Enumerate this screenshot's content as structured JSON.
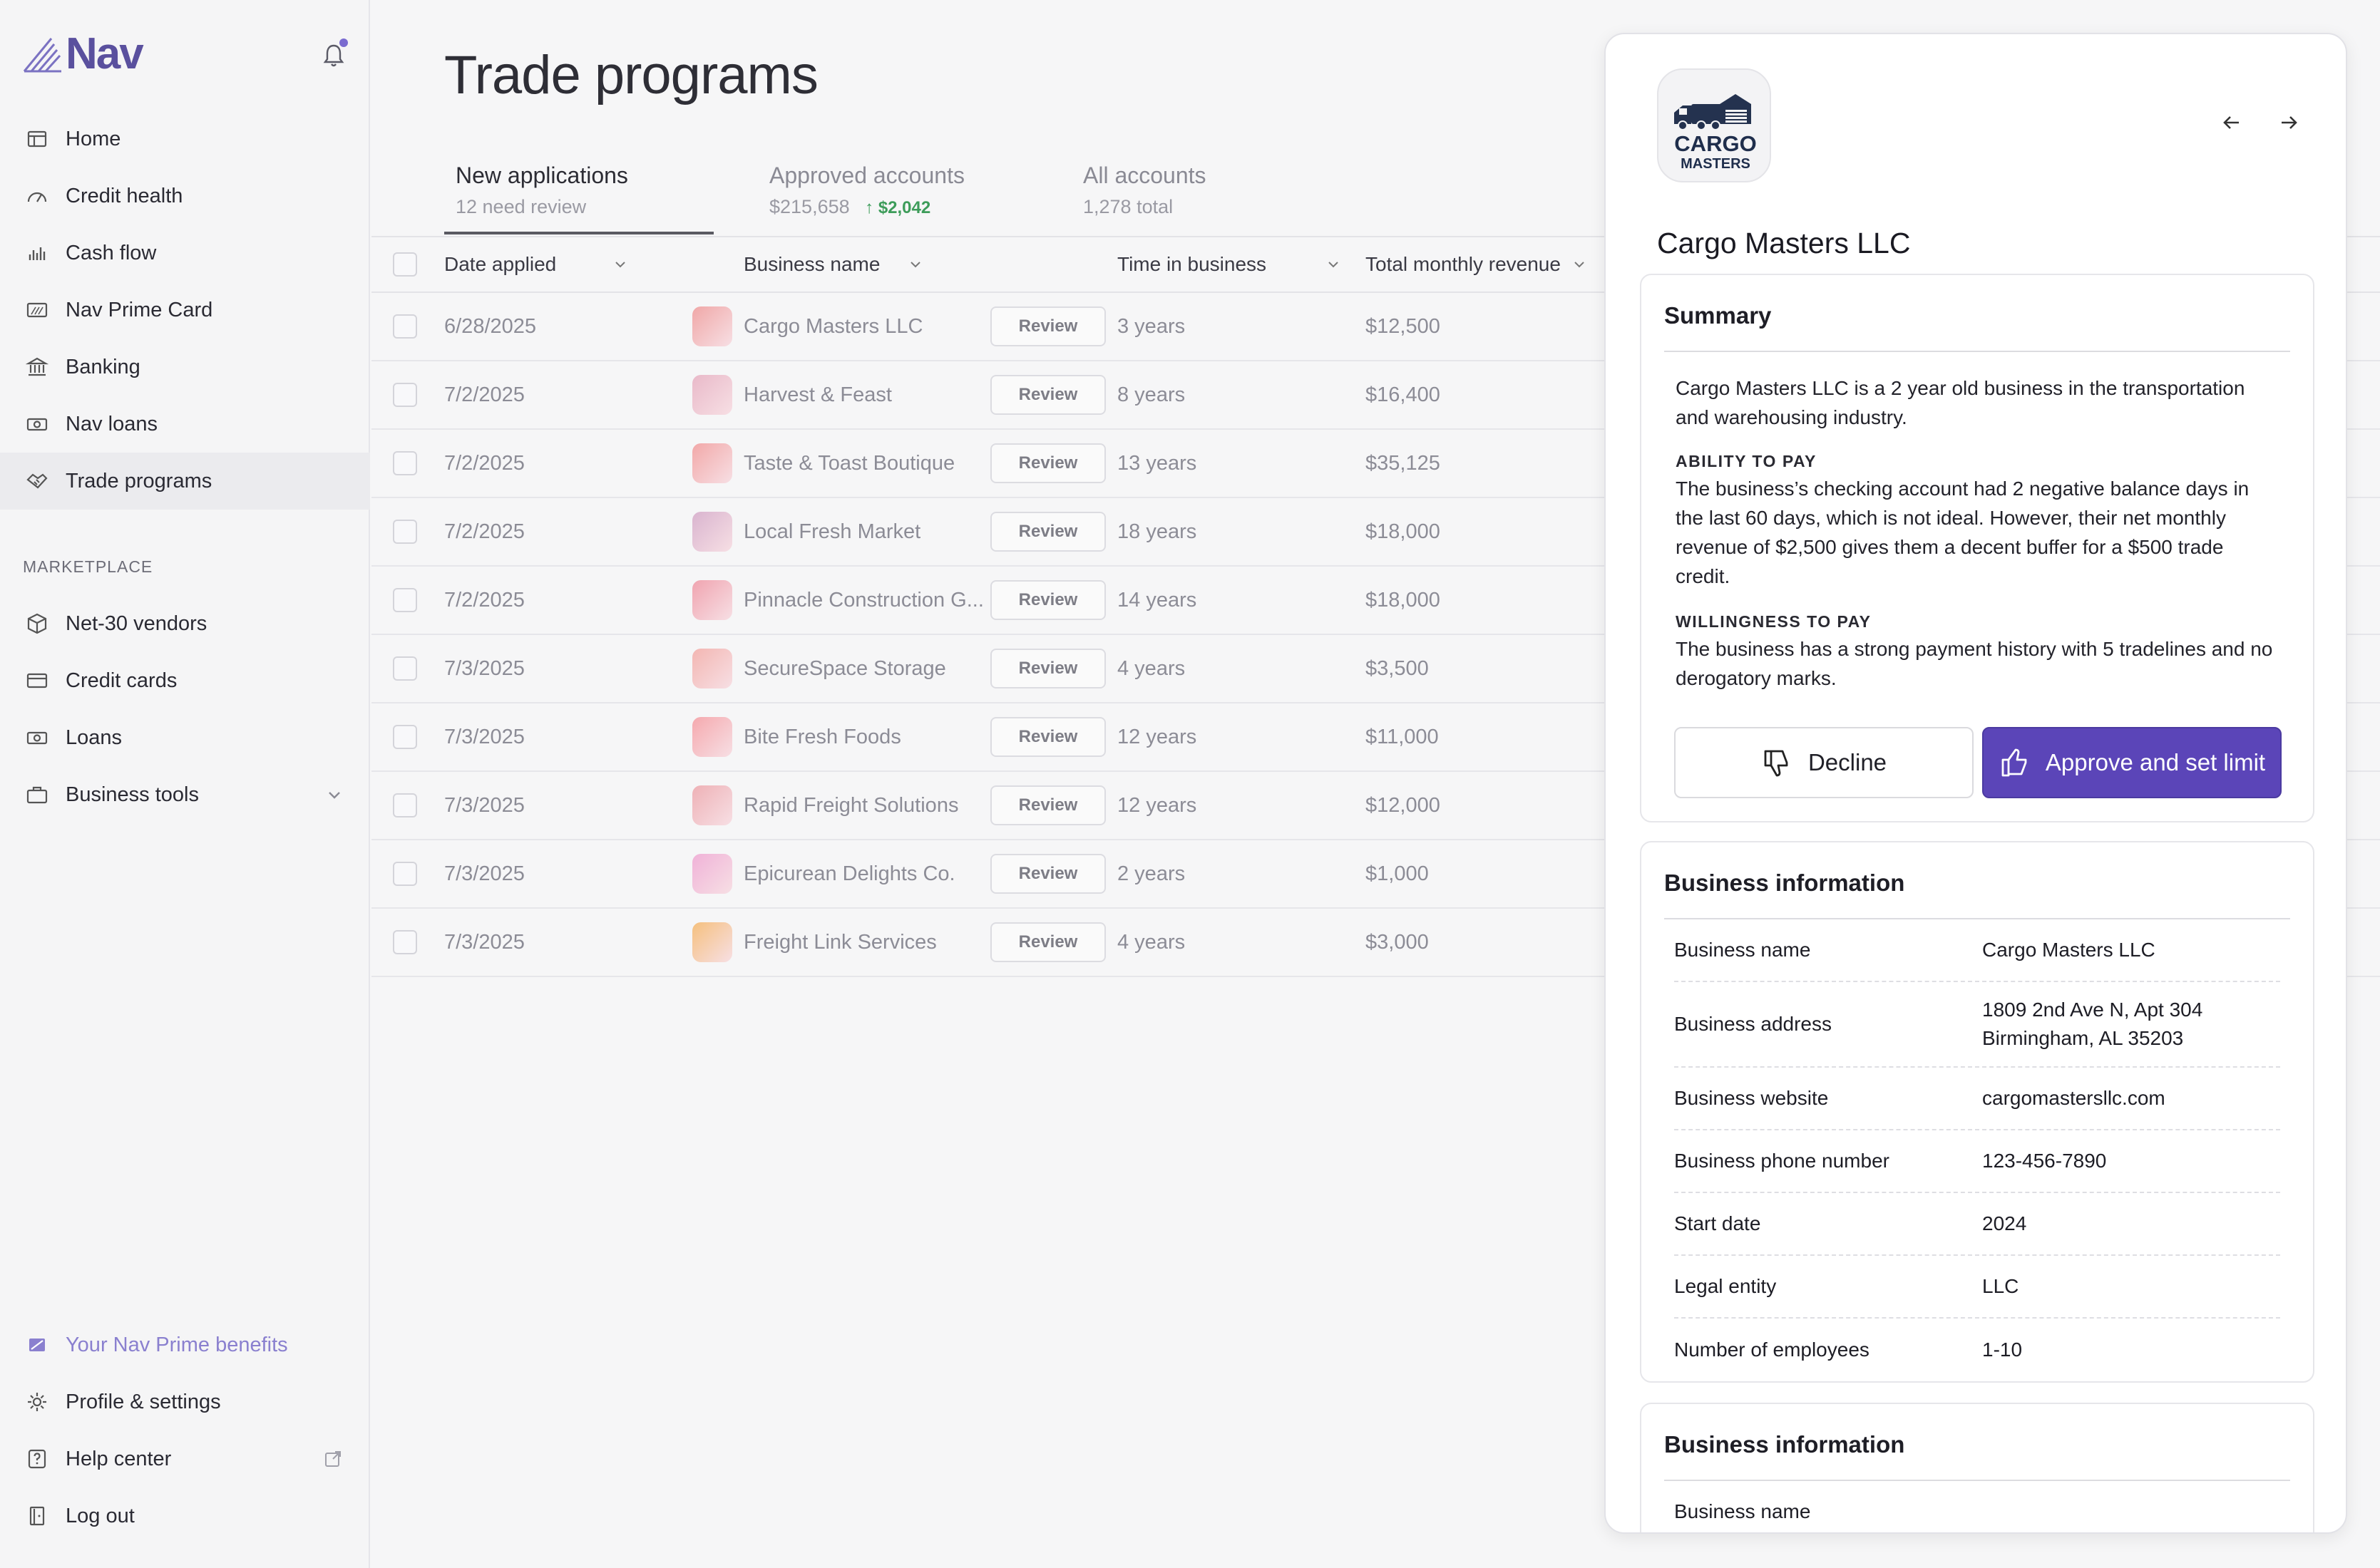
{
  "app": {
    "logo_text": "Nav"
  },
  "sidebar": {
    "items": [
      {
        "label": "Home",
        "icon": "home-icon"
      },
      {
        "label": "Credit health",
        "icon": "gauge-icon"
      },
      {
        "label": "Cash flow",
        "icon": "bar-chart-icon"
      },
      {
        "label": "Nav Prime Card",
        "icon": "card-icon"
      },
      {
        "label": "Banking",
        "icon": "bank-icon"
      },
      {
        "label": "Nav loans",
        "icon": "cash-icon"
      },
      {
        "label": "Trade programs",
        "icon": "handshake-icon",
        "active": true
      }
    ],
    "marketplace_label": "MARKETPLACE",
    "marketplace": [
      {
        "label": "Net-30 vendors",
        "icon": "box-icon"
      },
      {
        "label": "Credit cards",
        "icon": "credit-card-icon"
      },
      {
        "label": "Loans",
        "icon": "cash-icon"
      },
      {
        "label": "Business tools",
        "icon": "briefcase-icon"
      }
    ],
    "bottom": [
      {
        "label": "Your Nav Prime benefits",
        "icon": "prime-icon"
      },
      {
        "label": "Profile & settings",
        "icon": "gear-icon"
      },
      {
        "label": "Help center",
        "icon": "help-icon"
      },
      {
        "label": "Log out",
        "icon": "logout-icon"
      }
    ]
  },
  "main": {
    "title": "Trade programs",
    "tabs": [
      {
        "label": "New applications",
        "sub": "12 need review"
      },
      {
        "label": "Approved accounts",
        "sub": "$215,658",
        "delta": "$2,042"
      },
      {
        "label": "All accounts",
        "sub": "1,278 total"
      }
    ],
    "columns": [
      "Date applied",
      "Business name",
      "Time in business",
      "Total monthly revenue"
    ],
    "review_label": "Review",
    "rows": [
      {
        "date": "6/28/2025",
        "name": "Cargo Masters LLC",
        "time": "3 years",
        "revenue": "$12,500",
        "color": "#f0a7a7"
      },
      {
        "date": "7/2/2025",
        "name": "Harvest & Feast",
        "time": "8 years",
        "revenue": "$16,400",
        "color": "#e9b9c9"
      },
      {
        "date": "7/2/2025",
        "name": "Taste & Toast Boutique",
        "time": "13 years",
        "revenue": "$35,125",
        "color": "#f2a8a8"
      },
      {
        "date": "7/2/2025",
        "name": "Local Fresh Market",
        "time": "18 years",
        "revenue": "$18,000",
        "color": "#d9b4cf"
      },
      {
        "date": "7/2/2025",
        "name": "Pinnacle Construction G...",
        "time": "14 years",
        "revenue": "$18,000",
        "color": "#f0a4b0"
      },
      {
        "date": "7/3/2025",
        "name": "SecureSpace Storage",
        "time": "4 years",
        "revenue": "$3,500",
        "color": "#f3b6b2"
      },
      {
        "date": "7/3/2025",
        "name": "Bite Fresh Foods",
        "time": "12 years",
        "revenue": "$11,000",
        "color": "#f5a9ae"
      },
      {
        "date": "7/3/2025",
        "name": "Rapid Freight Solutions",
        "time": "12 years",
        "revenue": "$12,000",
        "color": "#eeb1b6"
      },
      {
        "date": "7/3/2025",
        "name": "Epicurean Delights Co.",
        "time": "2 years",
        "revenue": "$1,000",
        "color": "#f0b2d8"
      },
      {
        "date": "7/3/2025",
        "name": "Freight Link Services",
        "time": "4 years",
        "revenue": "$3,000",
        "color": "#f5c07e"
      }
    ]
  },
  "panel": {
    "logo_top": "CARGO",
    "logo_bottom": "MASTERS",
    "title": "Cargo Masters LLC",
    "summary": {
      "heading": "Summary",
      "intro": "Cargo Masters LLC is a 2 year old business in the transportation and warehousing industry.",
      "ability_label": "ABILITY TO PAY",
      "ability_text": "The business’s checking account had 2 negative balance days in the last 60 days, which is not ideal. However, their net monthly revenue of $2,500 gives them a decent buffer for a $500 trade credit.",
      "willingness_label": "WILLINGNESS TO PAY",
      "willingness_text": "The business has a strong payment history with 5 tradelines and no derogatory marks.",
      "decline_label": "Decline",
      "approve_label": "Approve and set limit"
    },
    "business_info": {
      "heading": "Business information",
      "rows": [
        {
          "key": "Business name",
          "value": "Cargo Masters LLC"
        },
        {
          "key": "Business address",
          "value": "1809 2nd Ave N, Apt 304",
          "value2": "Birmingham, AL 35203"
        },
        {
          "key": "Business website",
          "value": "cargomastersllc.com"
        },
        {
          "key": "Business phone number",
          "value": "123-456-7890"
        },
        {
          "key": "Start date",
          "value": "2024"
        },
        {
          "key": "Legal entity",
          "value": "LLC"
        },
        {
          "key": "Number of employees",
          "value": "1-10"
        }
      ]
    },
    "business_info_2": {
      "heading": "Business information",
      "rows": [
        {
          "key": "Business name"
        }
      ]
    },
    "colors": {
      "accent": "#5b45b8",
      "positive": "#3d9c5a"
    }
  }
}
